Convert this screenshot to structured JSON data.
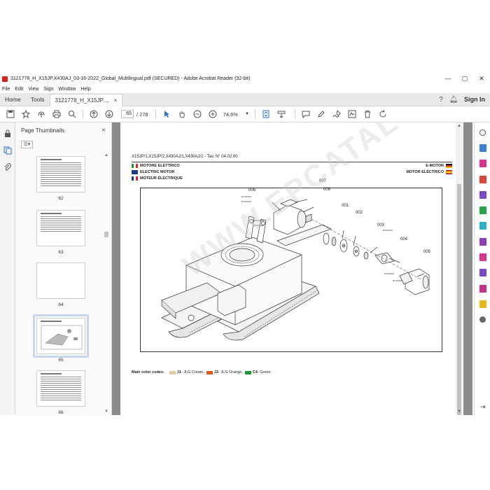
{
  "window": {
    "title": "3121778_H_X15JP,X430AJ_03-16-2022_Global_Multilingual.pdf (SECURED) - Adobe Acrobat Reader (32-bit)",
    "controls": [
      "—",
      "▢",
      "✕"
    ]
  },
  "menu": [
    "File",
    "Edit",
    "View",
    "Sign",
    "Window",
    "Help"
  ],
  "tabs": {
    "home": "Home",
    "tools": "Tools",
    "document": "3121778_H_X15JP....",
    "close": "×",
    "signin": "Sign In"
  },
  "toolbar": {
    "current_page": "65",
    "total_pages": "/ 278",
    "zoom": "74,6%"
  },
  "thumbnails": {
    "title": "Page Thumbnails",
    "close": "×",
    "pages": [
      {
        "num": "62",
        "selected": false
      },
      {
        "num": "63",
        "selected": false
      },
      {
        "num": "64",
        "selected": false
      },
      {
        "num": "65",
        "selected": true
      },
      {
        "num": "66",
        "selected": false
      }
    ]
  },
  "document": {
    "header": "X15JP/1,X15JP/2,X430AJ/1,X430AJ/2 - Tav. N° 04.02.00",
    "languages_left": [
      {
        "text": "MOTORE ELETTRICO",
        "flag": "it"
      },
      {
        "text": "ELECTRIC MOTOR",
        "flag": "uk"
      },
      {
        "text": "MOTEUR ÉLECTRIQUE",
        "flag": "fr"
      }
    ],
    "languages_right": [
      {
        "text": "E-MOTOR",
        "flag": "de"
      },
      {
        "text": "MOTOR  ELÉCTRICO",
        "flag": "es"
      }
    ],
    "callouts": [
      "006",
      "007",
      "008",
      "001",
      "002",
      "003",
      "004",
      "005"
    ],
    "small_labels": [
      "BV000000",
      "BV000000",
      "BV000000",
      "BV000000",
      "BV000000",
      "BV000000",
      "BV000000"
    ],
    "watermark": "WWW.EPCATALOGS.COM",
    "color_codes": {
      "label": "Main color codes:",
      "items": [
        {
          "code": "J1",
          "name": " - JLG Cream,",
          "color": "#e3cba3"
        },
        {
          "code": "J2",
          "name": " - JLG Orange,",
          "color": "#e25b1e"
        },
        {
          "code": "C4",
          "name": " - Green",
          "color": "#1f9a3a"
        }
      ]
    }
  },
  "colors": {
    "accent": "#2a6fc9",
    "adobe_red": "#d6261c",
    "doc_background": "#8c8c8c"
  }
}
